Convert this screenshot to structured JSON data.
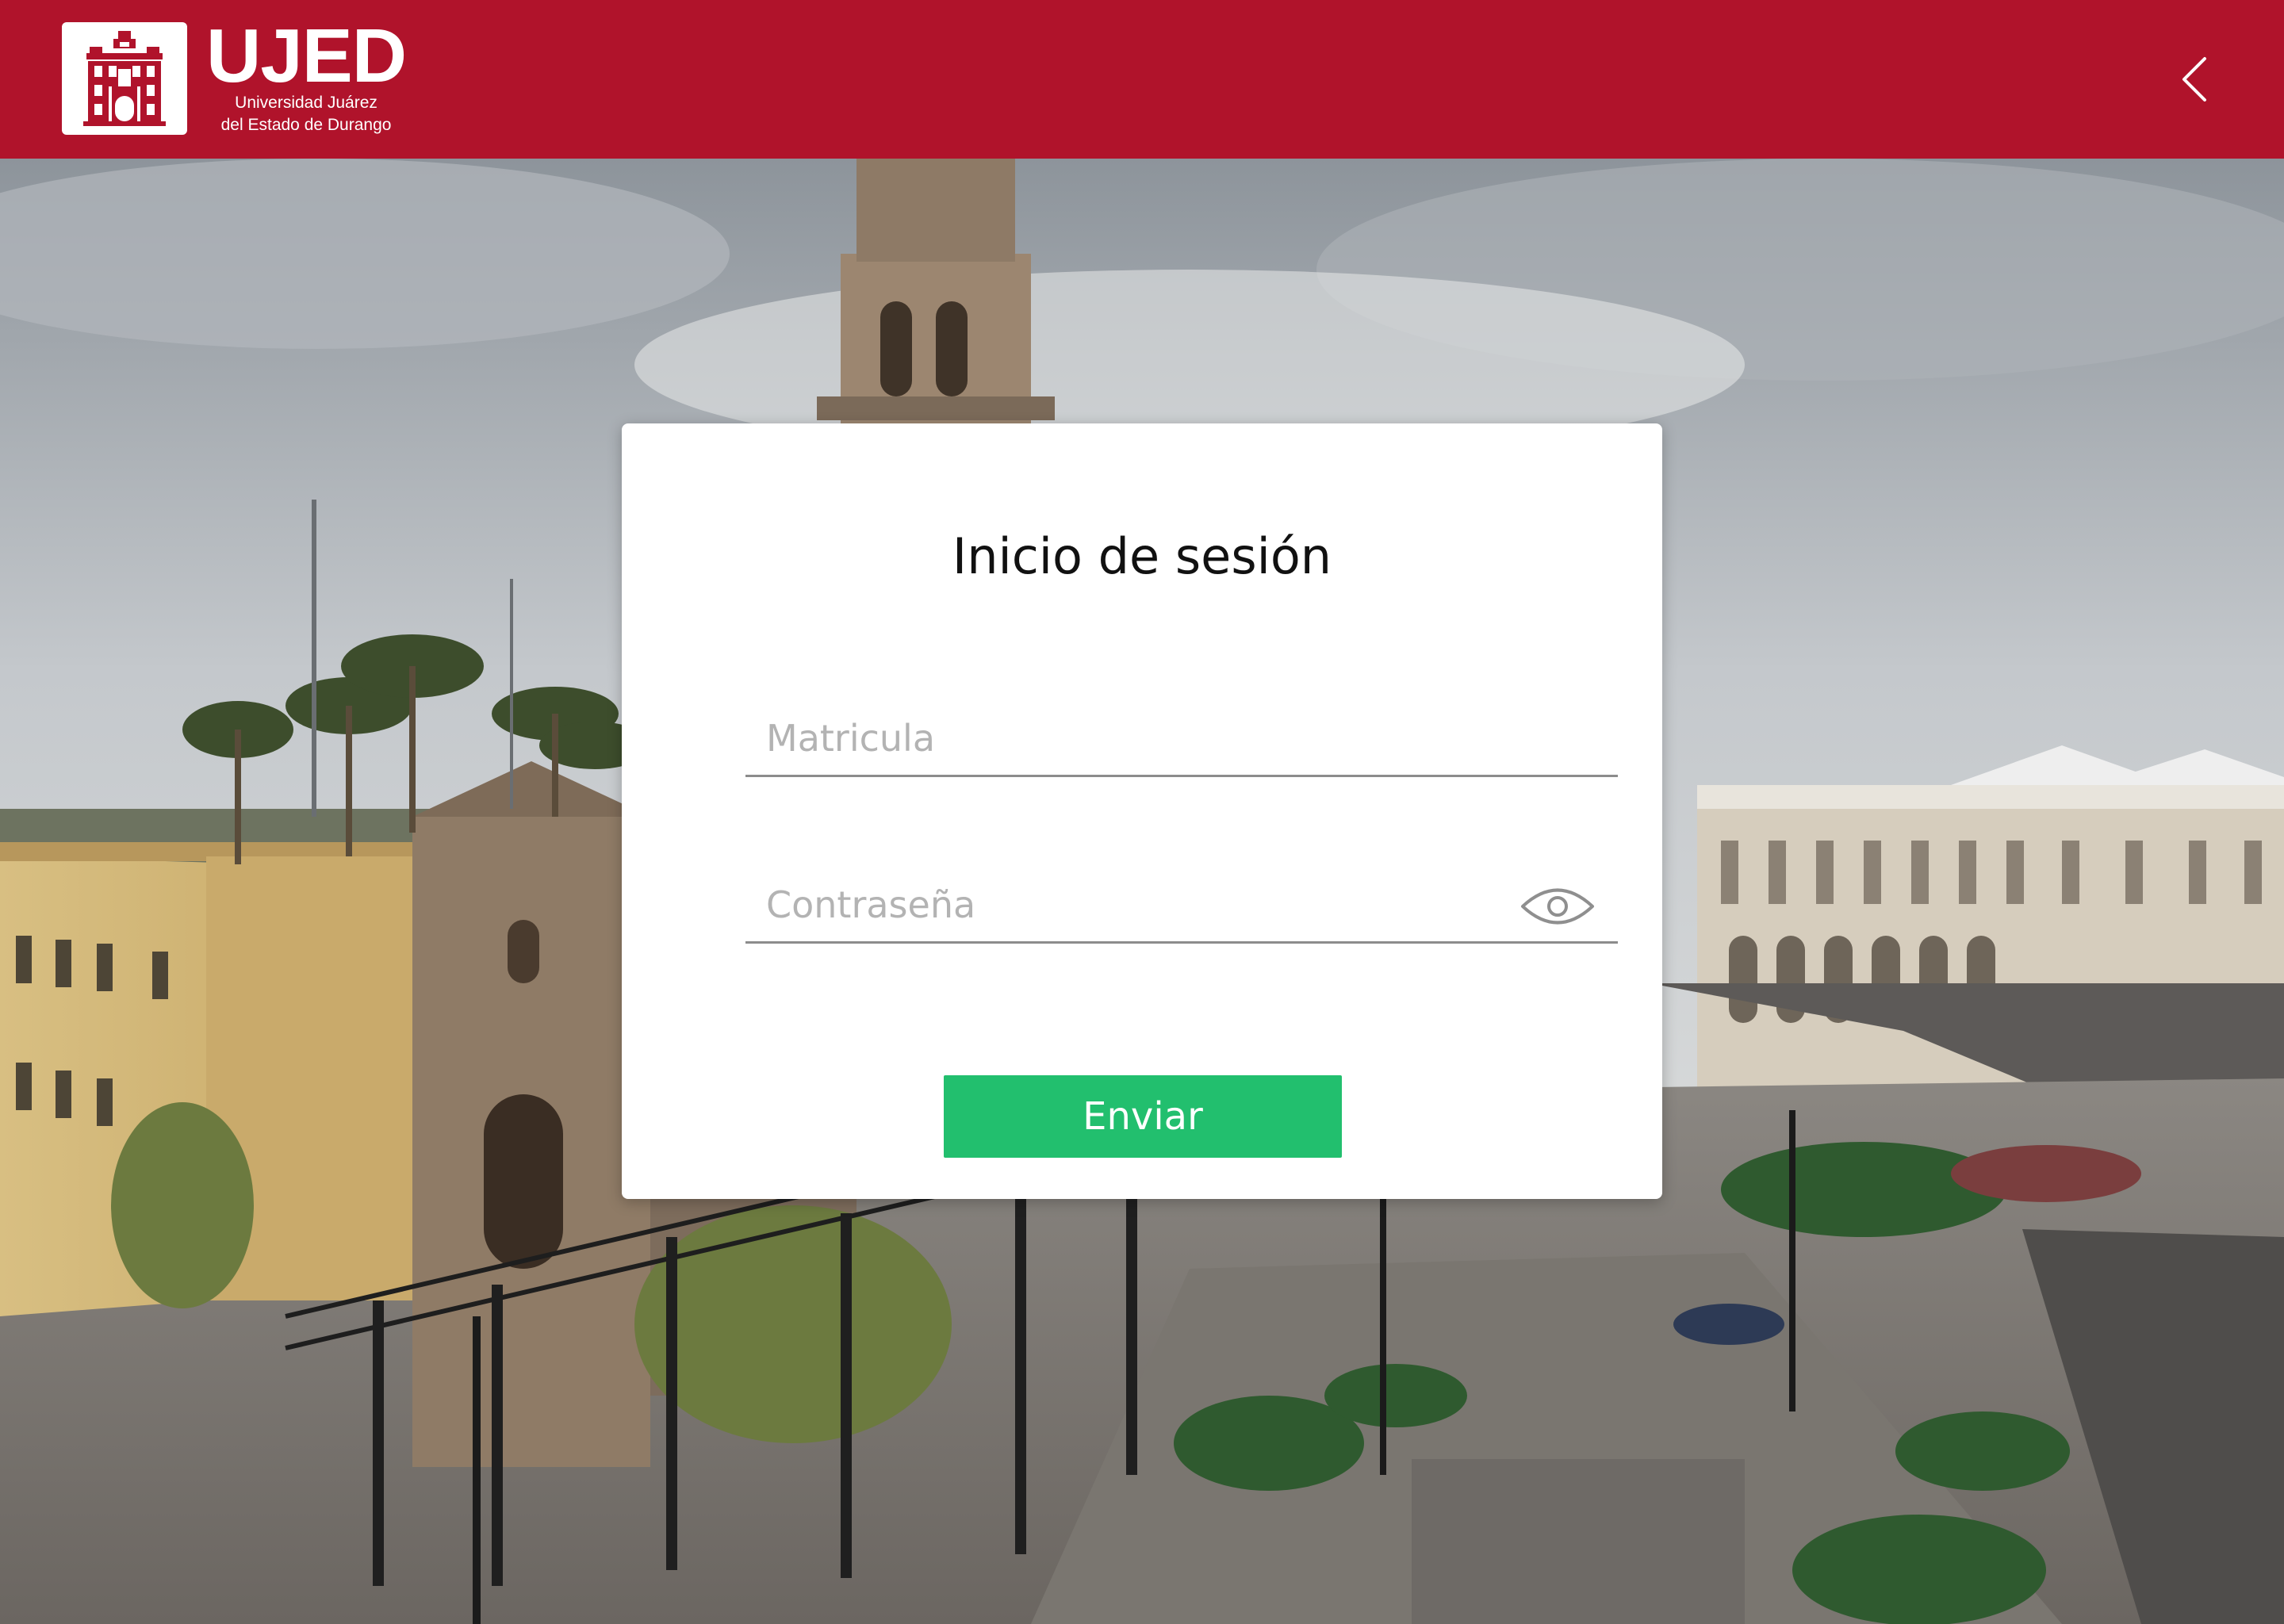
{
  "header": {
    "logo": {
      "acronym": "UJED",
      "name_line1": "Universidad Juárez",
      "name_line2": "del Estado de Durango",
      "badge_icon": "building-facade-icon"
    },
    "back_icon": "chevron-left-icon",
    "background_color": "#b0132b"
  },
  "login": {
    "title": "Inicio de sesión",
    "username": {
      "placeholder": "Matricula",
      "value": ""
    },
    "password": {
      "placeholder": "Contraseña",
      "value": "",
      "toggle_icon": "eye-icon"
    },
    "submit_label": "Enviar",
    "submit_color": "#22bf6e"
  },
  "background": {
    "description_icon": "city-plaza-photo"
  }
}
